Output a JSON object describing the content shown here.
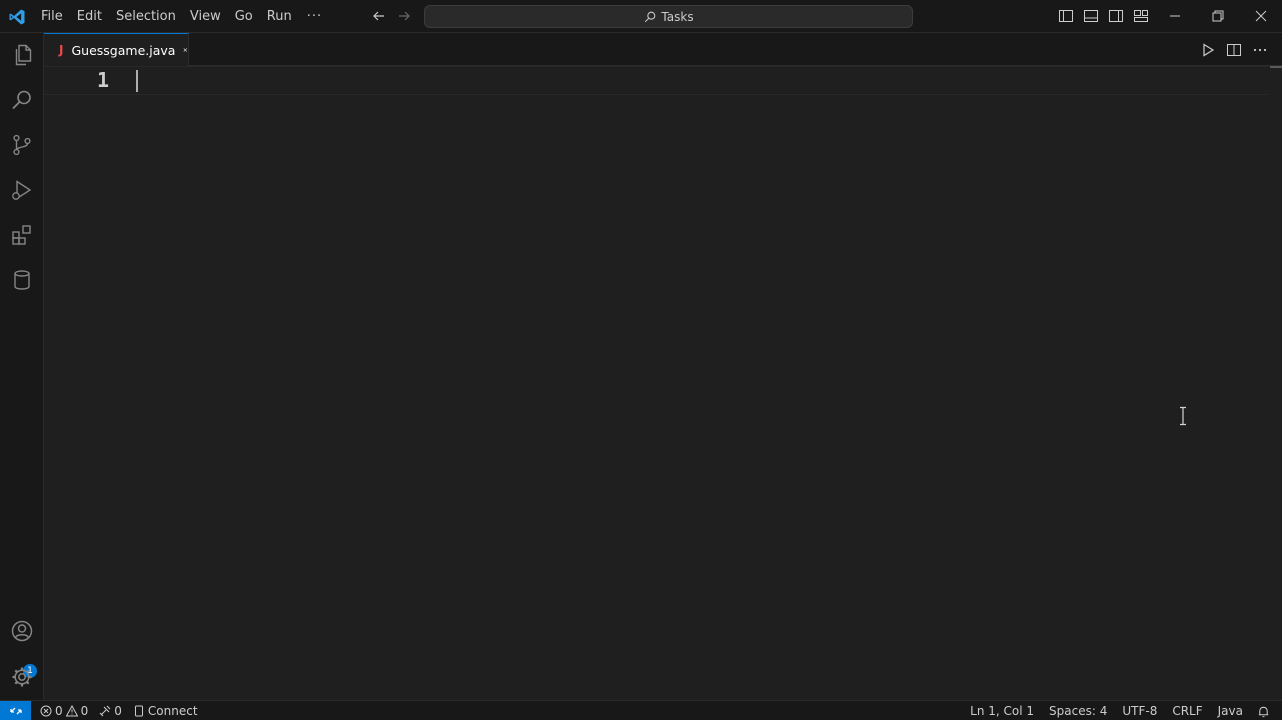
{
  "titlebar": {
    "menu": [
      "File",
      "Edit",
      "Selection",
      "View",
      "Go",
      "Run"
    ],
    "menu_more": "···",
    "command_center_label": "Tasks"
  },
  "activitybar": {
    "icons": [
      "explorer-icon",
      "search-icon",
      "source-control-icon",
      "run-debug-icon",
      "extensions-icon",
      "database-icon",
      "accounts-icon",
      "settings-gear-icon"
    ],
    "accounts_badge": "1"
  },
  "tabs": [
    {
      "icon_text": "J",
      "label": "Guessgame.java",
      "active": true
    }
  ],
  "editor": {
    "line_numbers": [
      "1"
    ]
  },
  "statusbar": {
    "errors": "0",
    "warnings": "0",
    "ports": "0",
    "connect_label": "Connect",
    "cursor_position": "Ln 1, Col 1",
    "indentation": "Spaces: 4",
    "encoding": "UTF-8",
    "line_ending": "CRLF",
    "language": "Java"
  },
  "colors": {
    "accent": "#0078d4",
    "background": "#1f1f1f",
    "chrome": "#181818",
    "java_icon": "#e84a4a"
  }
}
